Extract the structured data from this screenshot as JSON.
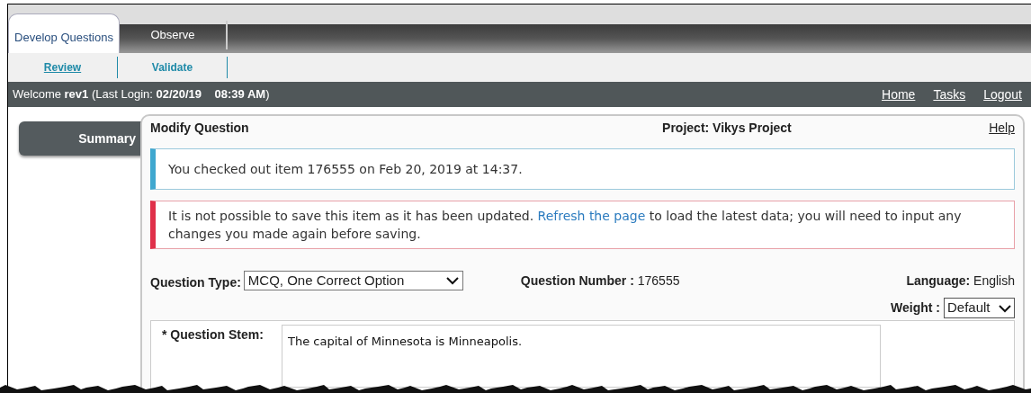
{
  "tabs": [
    {
      "label": "Develop Questions",
      "selected": true
    },
    {
      "label": "Observe",
      "selected": false
    }
  ],
  "subtabs": [
    {
      "label": "Review",
      "selected": true
    },
    {
      "label": "Validate",
      "selected": false
    }
  ],
  "welcome": "Welcome **rev1** (Last Login: **02/20/19    08:39 AM**)",
  "nav_links": [
    "Home",
    "Tasks",
    "Logout"
  ],
  "sidebar": {
    "button": "Summary"
  },
  "panel": {
    "title": "Modify Question",
    "project": "Project: Vikys Project",
    "help": "Help"
  },
  "alerts": [
    {
      "kind": "info",
      "text": "You checked out item 176555 on Feb 20, 2019 at 14:37."
    },
    {
      "kind": "error",
      "text_before": "It is not possible to save this item as it has been updated. ",
      "link": "Refresh the page",
      "text_after": " to load the latest data; you will need to input any changes you made again before saving."
    }
  ],
  "question_type": {
    "label": "Question Type:",
    "value": "MCQ, One Correct Option"
  },
  "question_number": {
    "label": "Question Number :",
    "value": "176555"
  },
  "language": {
    "label": "Language:",
    "value": "English"
  },
  "weight": {
    "label": "Weight :",
    "value": "Default"
  },
  "stem": {
    "label": "* Question Stem:",
    "value": "The capital of Minnesota is Minneapolis."
  }
}
